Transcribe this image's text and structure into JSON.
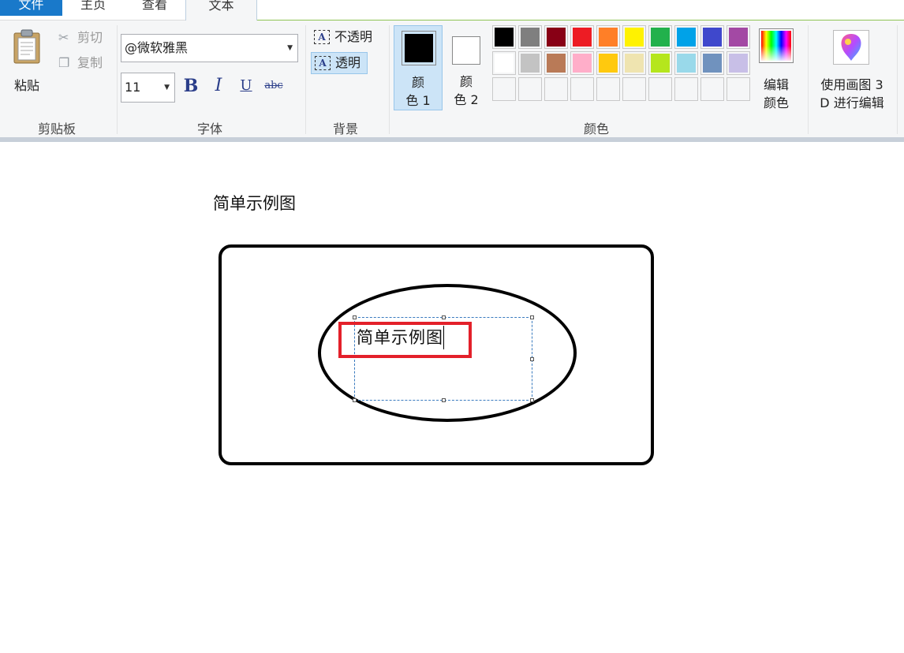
{
  "tabs": {
    "file": "文件",
    "home": "主页",
    "view": "查看",
    "text": "文本"
  },
  "clipboard": {
    "paste": "粘贴",
    "cut": "剪切",
    "copy": "复制",
    "group_label": "剪贴板"
  },
  "font": {
    "family": "@微软雅黑",
    "size": "11",
    "bold": "B",
    "italic": "I",
    "underline": "U",
    "strike": "abc",
    "group_label": "字体"
  },
  "background": {
    "opaque": "不透明",
    "transparent": "透明",
    "selected": "transparent",
    "group_label": "背景"
  },
  "colors": {
    "color1_line1": "颜",
    "color1_line2": "色 1",
    "color1_value": "#000000",
    "color2_line1": "颜",
    "color2_line2": "色 2",
    "color2_value": "#ffffff",
    "edit_line1": "编辑",
    "edit_line2": "颜色",
    "group_label": "颜色",
    "palette_row1": [
      "#000000",
      "#7f7f7f",
      "#880015",
      "#ed1c24",
      "#ff7f27",
      "#fff200",
      "#22b14c",
      "#00a2e8",
      "#3f48cc",
      "#a349a4"
    ],
    "palette_row2": [
      "#ffffff",
      "#c3c3c3",
      "#b97a57",
      "#ffaec9",
      "#ffc90e",
      "#efe4b0",
      "#b5e61d",
      "#99d9ea",
      "#7092be",
      "#c8bfe7"
    ]
  },
  "paint3d": {
    "line1": "使用画图 3",
    "line2": "D 进行编辑"
  },
  "canvas": {
    "title": "简单示例图",
    "vertical_text": "简单示例图"
  },
  "icons": {
    "paste": "clipboard-icon",
    "cut": "scissors-icon",
    "copy": "copy-icon",
    "edit_colors": "color-spectrum-icon",
    "paint3d": "paint3d-logo-icon"
  }
}
